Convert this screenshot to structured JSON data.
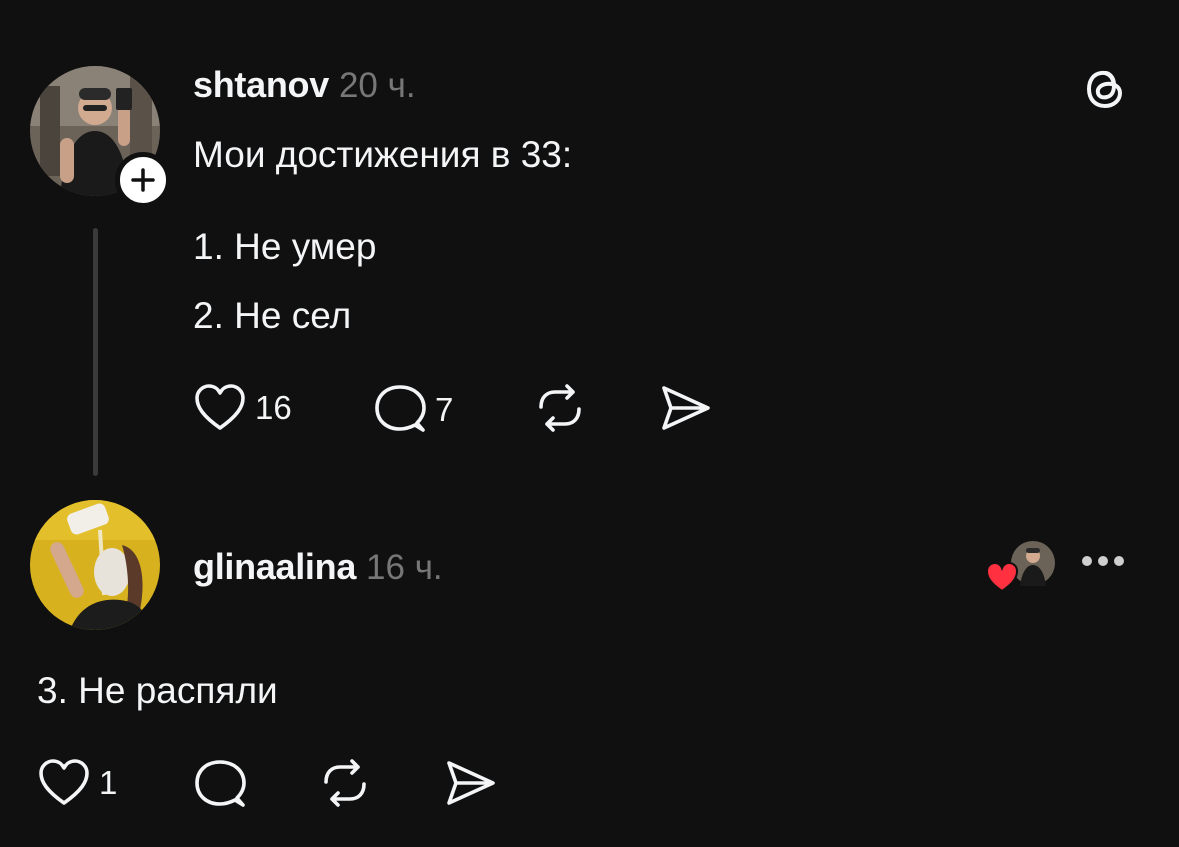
{
  "post": {
    "username": "shtanov",
    "time": "20 ч.",
    "lines": [
      "Мои достижения в 33:",
      "1. Не умер",
      "2. Не сел"
    ],
    "likes": "16",
    "comments": "7",
    "avatar_icon": "avatar-photo",
    "follow_icon": "plus-icon"
  },
  "reply": {
    "username": "glinaalina",
    "time": "16 ч.",
    "text": "3. Не распяли",
    "likes": "1",
    "liked_by_author_icon": "heart-icon"
  },
  "header": {
    "logo_icon": "threads-logo-icon"
  },
  "colors": {
    "background": "#101010",
    "text": "#f3f5f7",
    "muted": "#777777",
    "heart": "#ff3040"
  }
}
